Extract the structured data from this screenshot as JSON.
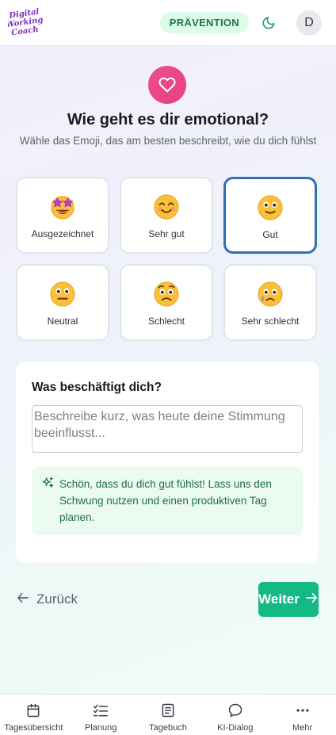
{
  "header": {
    "logo_lines": [
      "Digital",
      "Working",
      "Coach"
    ],
    "badge": "PRÄVENTION",
    "avatar_initial": "D",
    "icons": [
      "moon-icon"
    ]
  },
  "question": {
    "icon": "heart-icon",
    "title": "Wie geht es dir emotional?",
    "subtitle": "Wähle das Emoji, das am besten beschreibt, wie du dich fühlst"
  },
  "moods": [
    {
      "label": "Ausgezeichnet",
      "icon": "star-struck-emoji",
      "selected": false
    },
    {
      "label": "Sehr gut",
      "icon": "smiling-face-emoji",
      "selected": false
    },
    {
      "label": "Gut",
      "icon": "slightly-smiling-face-emoji",
      "selected": true
    },
    {
      "label": "Neutral",
      "icon": "neutral-face-emoji",
      "selected": false
    },
    {
      "label": "Schlecht",
      "icon": "worried-face-emoji",
      "selected": false
    },
    {
      "label": "Sehr schlecht",
      "icon": "crying-face-emoji",
      "selected": false
    }
  ],
  "concern": {
    "title": "Was beschäftigt dich?",
    "placeholder": "Beschreibe kurz, was heute deine Stimmung beeinflusst...",
    "value": "",
    "hint": "Schön, dass du dich gut fühlst! Lass uns den Schwung nutzen und einen produktiven Tag planen."
  },
  "navigation": {
    "back_label": "Zurück",
    "next_label": "Weiter"
  },
  "bottom_nav": [
    {
      "label": "Tagesübersicht",
      "icon": "calendar-icon"
    },
    {
      "label": "Planung",
      "icon": "checklist-icon"
    },
    {
      "label": "Tagebuch",
      "icon": "book-icon"
    },
    {
      "label": "KI-Dialog",
      "icon": "chat-bubble-icon"
    },
    {
      "label": "Mehr",
      "icon": "more-dots-icon"
    }
  ],
  "colors": {
    "accent": "#14b985",
    "selected_border": "#2e70b8",
    "badge_bg": "#dcfbe8",
    "heart_bg": "#e8417c"
  }
}
